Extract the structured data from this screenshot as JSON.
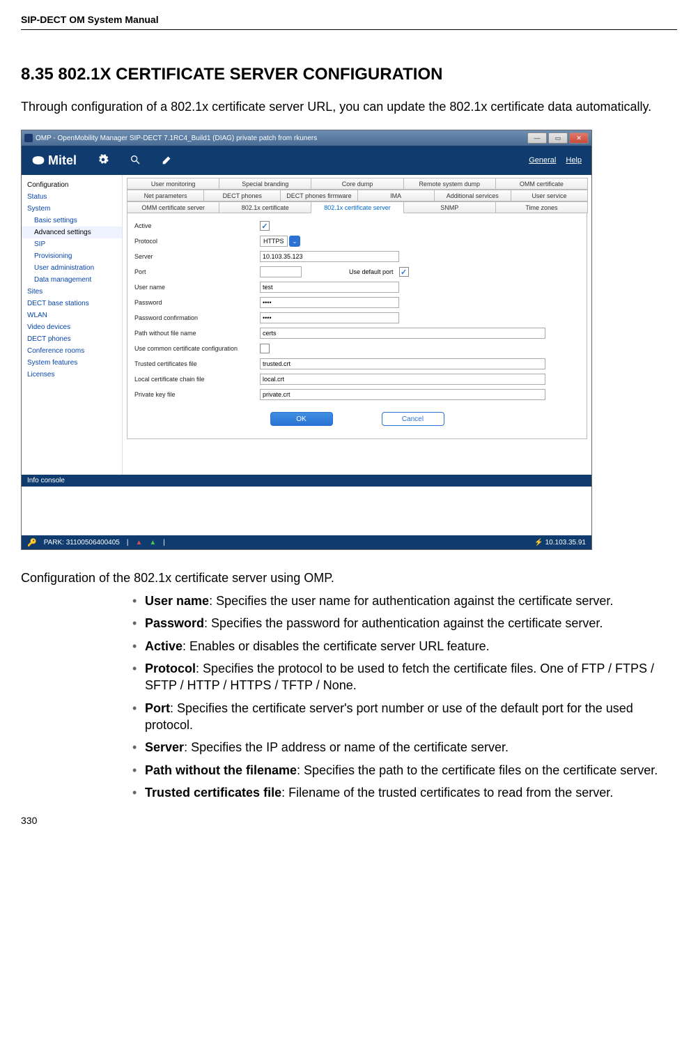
{
  "doc": {
    "header": "SIP-DECT OM System Manual",
    "section_heading": "8.35 802.1X CERTIFICATE SERVER CONFIGURATION",
    "intro": "Through configuration of a 802.1x certificate server URL, you can update the 802.1x certificate data automatically.",
    "caption": "Configuration of the 802.1x certificate server using OMP.",
    "bullets": [
      {
        "term": "User name",
        "desc": ": Specifies the user name for authentication against the certificate server."
      },
      {
        "term": "Password",
        "desc": ": Specifies the password for authentication against the certificate server."
      },
      {
        "term": "Active",
        "desc": ": Enables or disables the certificate server URL feature."
      },
      {
        "term": "Protocol",
        "desc": ": Specifies the protocol to be used to fetch the certificate files. One of FTP / FTPS / SFTP / HTTP / HTTPS / TFTP / None."
      },
      {
        "term": "Port",
        "desc": ": Specifies the certificate server's port number or use of the default port for the used protocol."
      },
      {
        "term": "Server",
        "desc": ": Specifies the IP address or name of the certificate server."
      },
      {
        "term": "Path without the filename",
        "desc": ": Specifies the path to the certificate files on the certificate server."
      },
      {
        "term": "Trusted certificates file",
        "desc": ": Filename of the trusted certificates to read from the server."
      }
    ],
    "page_number": "330"
  },
  "app": {
    "window_title": "OMP - OpenMobility Manager SIP-DECT 7.1RC4_Build1 (DIAG) private patch from rkuners",
    "brand": "Mitel",
    "top_links": {
      "general": "General",
      "help": "Help"
    },
    "sidebar": {
      "title": "Configuration",
      "items": [
        {
          "label": "Status",
          "lvl": 0
        },
        {
          "label": "System",
          "lvl": 0
        },
        {
          "label": "Basic settings",
          "lvl": 1
        },
        {
          "label": "Advanced settings",
          "lvl": 1,
          "selected": true
        },
        {
          "label": "SIP",
          "lvl": 1
        },
        {
          "label": "Provisioning",
          "lvl": 1
        },
        {
          "label": "User administration",
          "lvl": 1
        },
        {
          "label": "Data management",
          "lvl": 1
        },
        {
          "label": "Sites",
          "lvl": 0
        },
        {
          "label": "DECT base stations",
          "lvl": 0
        },
        {
          "label": "WLAN",
          "lvl": 0
        },
        {
          "label": "Video devices",
          "lvl": 0
        },
        {
          "label": "DECT phones",
          "lvl": 0
        },
        {
          "label": "Conference rooms",
          "lvl": 0
        },
        {
          "label": "System features",
          "lvl": 0
        },
        {
          "label": "Licenses",
          "lvl": 0
        }
      ]
    },
    "tabs_row1": [
      "User monitoring",
      "Special branding",
      "Core dump",
      "Remote system dump",
      "OMM certificate"
    ],
    "tabs_row2": [
      "Net parameters",
      "DECT phones",
      "DECT phones firmware",
      "IMA",
      "Additional services",
      "User service"
    ],
    "tabs_row3": [
      "OMM certificate server",
      "802.1x certificate",
      "802.1x certificate server",
      "SNMP",
      "Time zones"
    ],
    "active_tab": "802.1x certificate server",
    "form": {
      "active_label": "Active",
      "protocol_label": "Protocol",
      "protocol_value": "HTTPS",
      "server_label": "Server",
      "server_value": "10.103.35.123",
      "port_label": "Port",
      "port_value": "",
      "use_default_port_label": "Use default port",
      "username_label": "User name",
      "username_value": "test",
      "password_label": "Password",
      "password_value": "••••",
      "password_conf_label": "Password confirmation",
      "password_conf_value": "••••",
      "path_label": "Path without file name",
      "path_value": "certs",
      "use_common_label": "Use common certificate configuration",
      "trusted_label": "Trusted certificates file",
      "trusted_value": "trusted.crt",
      "local_label": "Local certificate chain file",
      "local_value": "local.crt",
      "private_label": "Private key file",
      "private_value": "private.crt",
      "ok": "OK",
      "cancel": "Cancel"
    },
    "info_console": "Info console",
    "status_park": "PARK: 31100506400405",
    "status_ip": "10.103.35.91"
  }
}
